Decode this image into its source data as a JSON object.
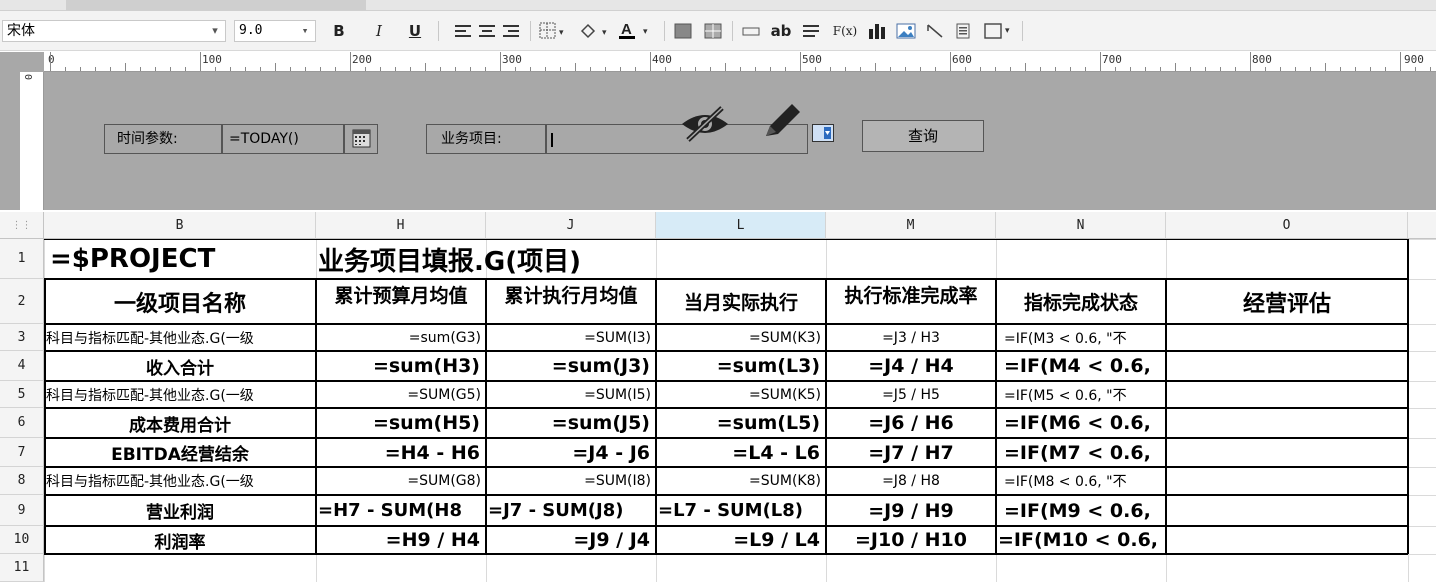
{
  "toolbar": {
    "font_name": "宋体",
    "font_size": "9.0",
    "bold": "B",
    "italic": "I",
    "underline": "U",
    "text_btn": "ab",
    "formula_btn": "F(x)"
  },
  "ruler": {
    "top_marks": [
      "0",
      "100",
      "200",
      "300",
      "400",
      "500",
      "600",
      "700",
      "800",
      "900"
    ],
    "left_mark": "0"
  },
  "params": {
    "time_label": "时间参数:",
    "time_value": "=TODAY()",
    "project_label": "业务项目:",
    "query_label": "查询"
  },
  "sheet": {
    "columns": [
      "B",
      "H",
      "J",
      "L",
      "M",
      "N",
      "O"
    ],
    "rows": [
      "1",
      "2",
      "3",
      "4",
      "5",
      "6",
      "7",
      "8",
      "9",
      "10",
      "11"
    ],
    "r1": {
      "b": "=$PROJECT",
      "h": "业务项目填报.G(项目)"
    },
    "r2": {
      "b": "一级项目名称",
      "h": "累计预算月均值",
      "j": "累计执行月均值",
      "l": "当月实际执行",
      "m": "执行标准完成率",
      "n": "指标完成状态",
      "o": "经营评估"
    },
    "r3": {
      "b": "科目与指标匹配-其他业态.G(一级",
      "h": "=sum(G3)",
      "j": "=SUM(I3)",
      "l": "=SUM(K3)",
      "m": "=J3 / H3",
      "n": "=IF(M3 < 0.6, \"不"
    },
    "r4": {
      "b": "收入合计",
      "h": "=sum(H3)",
      "j": "=sum(J3)",
      "l": "=sum(L3)",
      "m": "=J4 / H4",
      "n": "=IF(M4 < 0.6,"
    },
    "r5": {
      "b": "科目与指标匹配-其他业态.G(一级",
      "h": "=SUM(G5)",
      "j": "=SUM(I5)",
      "l": "=SUM(K5)",
      "m": "=J5 / H5",
      "n": "=IF(M5 < 0.6, \"不"
    },
    "r6": {
      "b": "成本费用合计",
      "h": "=sum(H5)",
      "j": "=sum(J5)",
      "l": "=sum(L5)",
      "m": "=J6 / H6",
      "n": "=IF(M6 < 0.6,"
    },
    "r7": {
      "b": "EBITDA经营结余",
      "h": "=H4 - H6",
      "j": "=J4 - J6",
      "l": "=L4 - L6",
      "m": "=J7 / H7",
      "n": "=IF(M7 < 0.6,"
    },
    "r8": {
      "b": "科目与指标匹配-其他业态.G(一级",
      "h": "=SUM(G8)",
      "j": "=SUM(I8)",
      "l": "=SUM(K8)",
      "m": "=J8 / H8",
      "n": "=IF(M8 < 0.6, \"不"
    },
    "r9": {
      "b": "营业利润",
      "h": "=H7 - SUM(H8",
      "j": "=J7 - SUM(J8)",
      "l": "=L7 - SUM(L8)",
      "m": "=J9 / H9",
      "n": "=IF(M9 < 0.6,"
    },
    "r10": {
      "b": "利润率",
      "h": "=H9 / H4",
      "j": "=J9 / J4",
      "l": "=L9 / L4",
      "m": "=J10 / H10",
      "n": "=IF(M10 < 0.6,"
    }
  }
}
